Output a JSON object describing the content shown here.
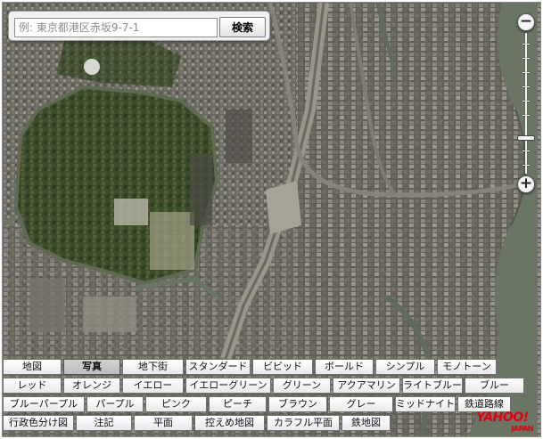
{
  "search": {
    "placeholder": "例: 東京都港区赤坂9-7-1",
    "value": "",
    "button_label": "検索"
  },
  "zoom": {
    "in_symbol": "+",
    "out_symbol": "−",
    "level_fraction": 0.75
  },
  "style_buttons": {
    "row1": [
      "地図",
      "写真",
      "地下街",
      "スタンダード",
      "ビビッド",
      "ボールド",
      "シンプル",
      "モノトーン"
    ],
    "row2": [
      "レッド",
      "オレンジ",
      "イエロー",
      "イエローグリーン",
      "グリーン",
      "アクアマリン",
      "ライトブルー",
      "ブルー"
    ],
    "row3": [
      "ブルーパープル",
      "パープル",
      "ピンク",
      "ピーチ",
      "ブラウン",
      "グレー",
      "ミッドナイト",
      "鉄道路線"
    ],
    "row4": [
      "行政色分け図",
      "注記",
      "平面",
      "控えめ地図",
      "カラフル平面",
      "鉄地図"
    ],
    "active": "写真"
  },
  "logo": {
    "text": "YAHOO!",
    "sub": "JAPAN"
  },
  "colors": {
    "map_base": "#5b5a50",
    "park_green": "#3f4a2e",
    "water": "#6a7564",
    "button_active": "#c8c8c8",
    "logo_red": "#e00012"
  }
}
